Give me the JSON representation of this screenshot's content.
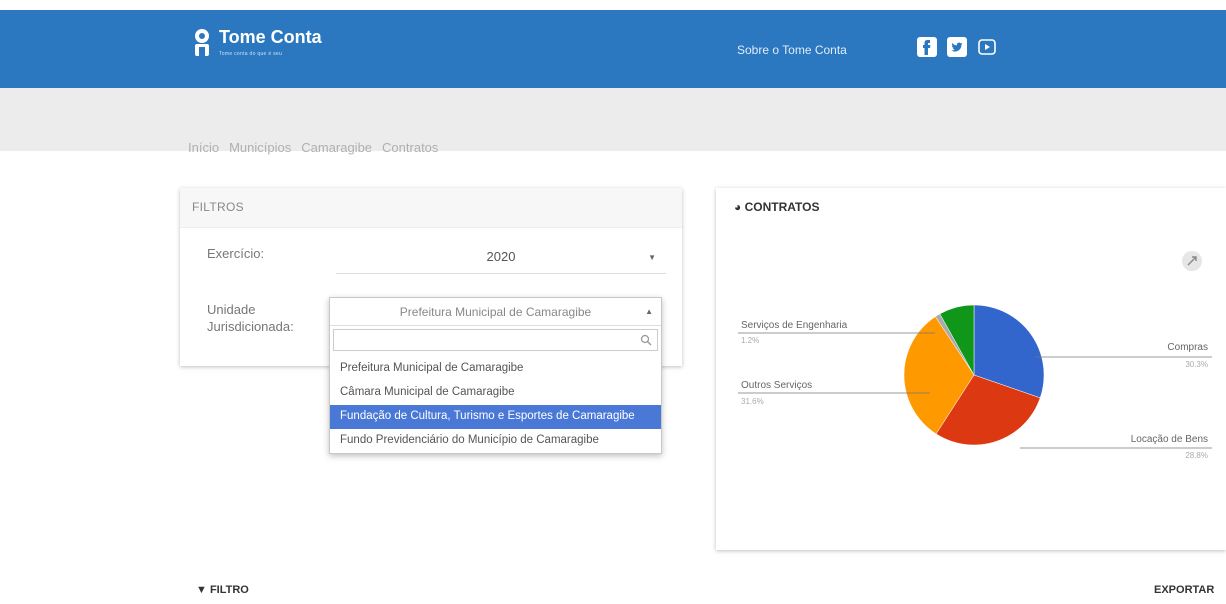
{
  "header": {
    "brand": "Tome Conta",
    "tagline": "Tome conta do que é seu",
    "about": "Sobre o Tome Conta",
    "brand_color": "#2b78c0",
    "social": [
      "facebook-icon",
      "twitter-icon",
      "youtube-icon"
    ]
  },
  "breadcrumb": [
    "Início",
    "Municípios",
    "Camaragibe",
    "Contratos"
  ],
  "filters": {
    "title": "FILTROS",
    "exercicio_label": "Exercício:",
    "exercicio_value": "2020",
    "unidade_label_1": "Unidade",
    "unidade_label_2": "Jurisdicionada:",
    "unidade_value": "Prefeitura Municipal de Camaragibe",
    "options": [
      "Prefeitura Municipal de Camaragibe",
      "Câmara Municipal de Camaragibe",
      "Fundação de Cultura, Turismo e Esportes de Camaragibe",
      "Fundo Previdenciário do Município de Camaragibe"
    ],
    "active_option_index": 2
  },
  "contracts": {
    "title": "CONTRATOS"
  },
  "chart_data": {
    "type": "pie",
    "title": "",
    "slices": [
      {
        "label": "Compras",
        "share": 30.3,
        "pct_text": "30.3%",
        "color": "#3366cc"
      },
      {
        "label": "Locação de Bens",
        "share": 28.8,
        "pct_text": "28.8%",
        "color": "#dc3912"
      },
      {
        "label": "Outros Serviços",
        "share": 31.6,
        "pct_text": "31.6%",
        "color": "#ff9900"
      },
      {
        "label": "Serviços de Engenharia",
        "share": 1.2,
        "pct_text": "1.2%",
        "color": "#aaaaaa"
      },
      {
        "label": "",
        "share": 8.1,
        "pct_text": "",
        "color": "#109618"
      }
    ]
  },
  "bottom": {
    "filter": "FILTRO",
    "export": "EXPORTAR"
  }
}
